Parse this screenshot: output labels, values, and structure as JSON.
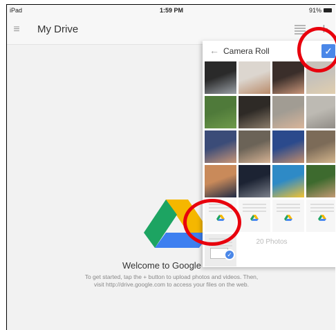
{
  "status_bar": {
    "carrier": "iPad",
    "time": "1:59 PM",
    "battery": "91%"
  },
  "app_bar": {
    "title": "My Drive"
  },
  "empty_state": {
    "welcome": "Welcome to Google",
    "line1": "To get started, tap the + button to upload photos and videos. Then,",
    "line2": "visit http://drive.google.com to access your files on the web."
  },
  "picker": {
    "title": "Camera Roll",
    "photo_count": "20 Photos",
    "thumbnails": [
      {
        "kind": "photo",
        "colors": [
          "#2a2a2a",
          "#9aa0a6"
        ]
      },
      {
        "kind": "photo",
        "colors": [
          "#dcd6cf",
          "#b98b6a"
        ]
      },
      {
        "kind": "photo",
        "colors": [
          "#3a2e2a",
          "#c9967a"
        ]
      },
      {
        "kind": "photo",
        "colors": [
          "#c7c2ba",
          "#e2cfae"
        ]
      },
      {
        "kind": "photo",
        "colors": [
          "#4f7a3a",
          "#6f9a4a"
        ]
      },
      {
        "kind": "photo",
        "colors": [
          "#2e2a26",
          "#8b7c6a"
        ]
      },
      {
        "kind": "photo",
        "colors": [
          "#a19c93",
          "#d9b59a"
        ]
      },
      {
        "kind": "photo",
        "colors": [
          "#bdbab3",
          "#8e8a84"
        ]
      },
      {
        "kind": "photo",
        "colors": [
          "#3b4c78",
          "#c99677"
        ]
      },
      {
        "kind": "photo",
        "colors": [
          "#6b6357",
          "#d6b394"
        ]
      },
      {
        "kind": "photo",
        "colors": [
          "#2b4a8c",
          "#c38e6c"
        ]
      },
      {
        "kind": "photo",
        "colors": [
          "#7c6b58",
          "#d8b98f"
        ]
      },
      {
        "kind": "photo",
        "colors": [
          "#c98a5a",
          "#1f2a44"
        ]
      },
      {
        "kind": "photo",
        "colors": [
          "#1c2333",
          "#7a7f8a"
        ]
      },
      {
        "kind": "photo",
        "colors": [
          "#2e8ac6",
          "#f1c232"
        ]
      },
      {
        "kind": "photo",
        "colors": [
          "#3d6a2e",
          "#c79b76"
        ]
      },
      {
        "kind": "doc",
        "selected": false
      },
      {
        "kind": "doc",
        "selected": false
      },
      {
        "kind": "doc",
        "selected": false
      },
      {
        "kind": "doc",
        "selected": false
      },
      {
        "kind": "doc",
        "selected": true
      }
    ]
  }
}
